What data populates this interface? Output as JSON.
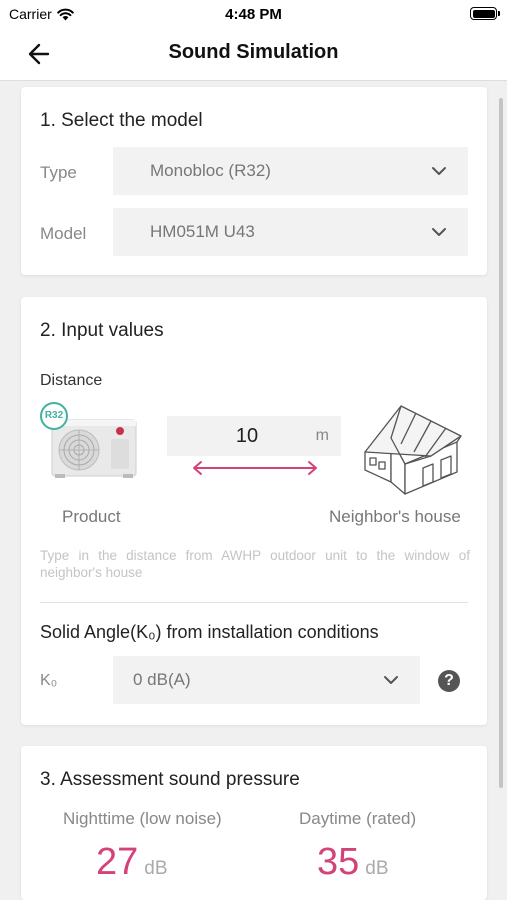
{
  "status_bar": {
    "carrier": "Carrier",
    "time": "4:48 PM"
  },
  "navbar": {
    "title": "Sound Simulation",
    "back_icon": "arrow-left-icon"
  },
  "section1": {
    "title": "1. Select the model",
    "type_label": "Type",
    "type_value": "Monobloc (R32)",
    "model_label": "Model",
    "model_value": "HM051M U43"
  },
  "section2": {
    "title": "2. Input values",
    "distance_label": "Distance",
    "r32_badge": "R32",
    "distance_value": "10",
    "distance_unit": "m",
    "product_label": "Product",
    "neighbor_label": "Neighbor's house",
    "hint": "Type in the distance from AWHP outdoor unit to the window of neighbor's house",
    "solid_angle_title": "Solid Angle(K₀) from installation conditions",
    "k0_label": "K₀",
    "k0_value": "0 dB(A)",
    "help_symbol": "?"
  },
  "section3": {
    "title": "3. Assessment sound pressure",
    "night_label": "Nighttime (low noise)",
    "night_value": "27",
    "night_unit": "dB",
    "day_label": "Daytime (rated)",
    "day_value": "35",
    "day_unit": "dB"
  },
  "colors": {
    "accent": "#d4427a",
    "badge": "#3fb3a0",
    "background": "#f0f0f0"
  }
}
